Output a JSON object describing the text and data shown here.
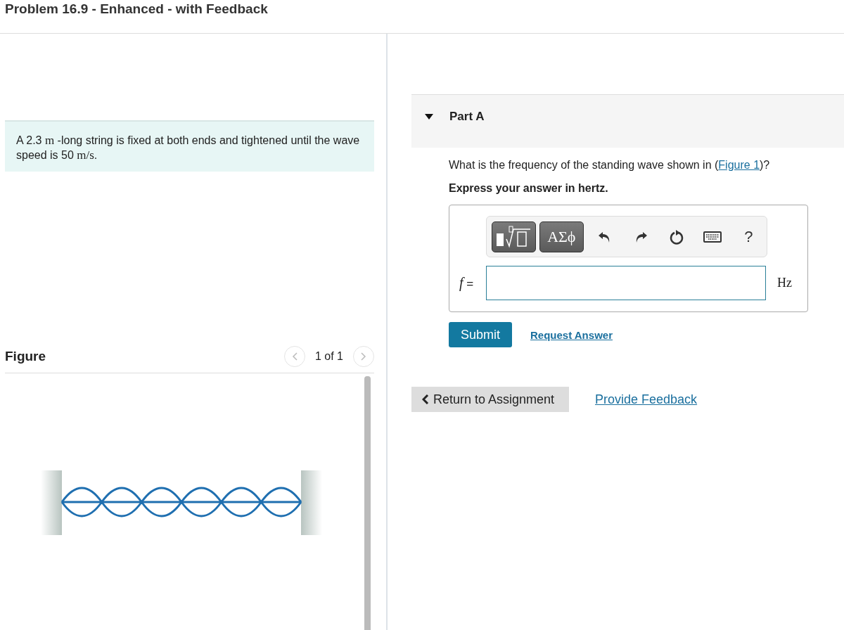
{
  "title": "Problem 16.9 - Enhanced - with Feedback",
  "problem": {
    "segments": [
      {
        "kind": "plain",
        "text": "A 2.3 "
      },
      {
        "kind": "math",
        "text": "m"
      },
      {
        "kind": "plain",
        "text": " -long string is fixed at both ends and tightened until the wave speed is 50 "
      },
      {
        "kind": "math",
        "text": "m/s"
      },
      {
        "kind": "plain",
        "text": "."
      }
    ]
  },
  "figure": {
    "title": "Figure",
    "pager": "1 of 1"
  },
  "part": {
    "title": "Part A",
    "expanded": true,
    "question": [
      {
        "kind": "plain",
        "text": "What is the frequency of the standing wave shown in ("
      },
      {
        "kind": "link",
        "text": "Figure 1"
      },
      {
        "kind": "plain",
        "text": ")?"
      }
    ],
    "instruction": "Express your answer in hertz.",
    "toolbar": [
      {
        "kind": "templates"
      },
      {
        "kind": "symbols",
        "text": "ΑΣϕ"
      },
      {
        "kind": "undo"
      },
      {
        "kind": "redo"
      },
      {
        "kind": "reset"
      },
      {
        "kind": "keyboard"
      },
      {
        "kind": "help",
        "text": "?"
      }
    ],
    "answer": {
      "variable": "f",
      "equals": "=",
      "unit": "Hz"
    },
    "submit": "Submit",
    "request": "Request Answer"
  },
  "return_button": "Return to Assignment",
  "feedback_link": "Provide Feedback"
}
